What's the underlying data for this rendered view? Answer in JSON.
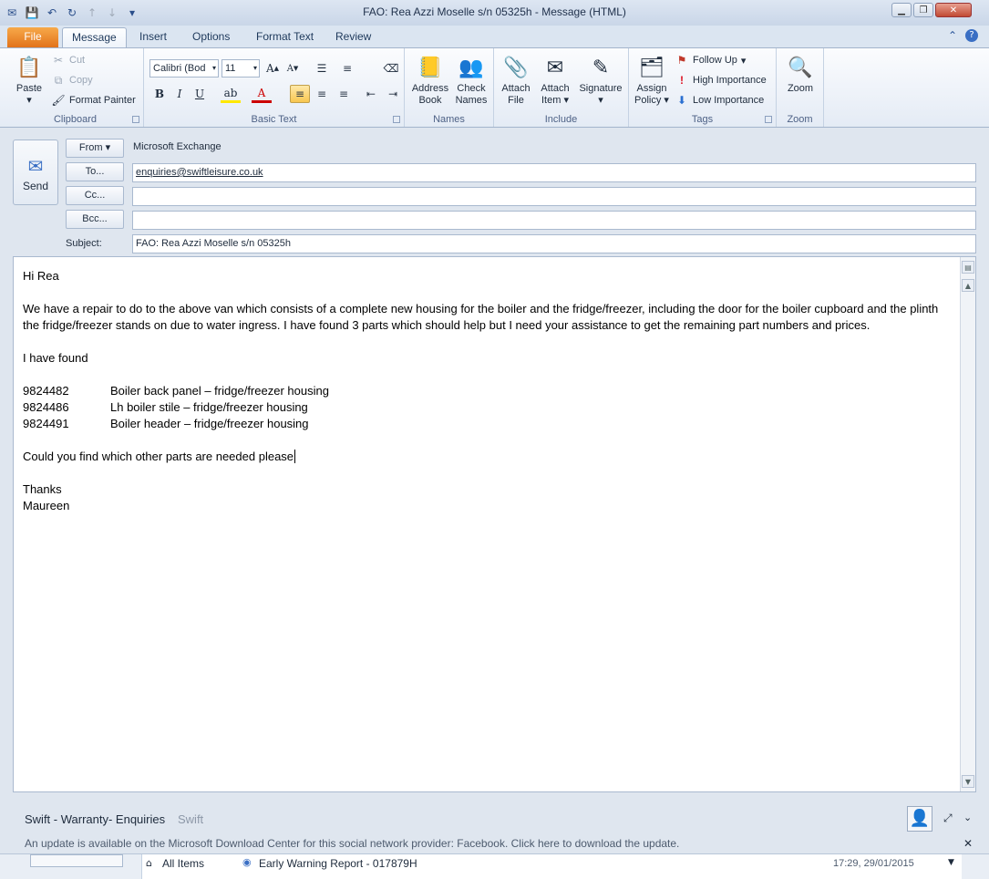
{
  "window": {
    "title": "FAO: Rea Azzi  Moselle  s/n 05325h  -  Message (HTML)"
  },
  "tabs": [
    "File",
    "Message",
    "Insert",
    "Options",
    "Format Text",
    "Review"
  ],
  "ribbon": {
    "clipboard": {
      "paste": "Paste",
      "cut": "Cut",
      "copy": "Copy",
      "format_painter": "Format Painter",
      "label": "Clipboard"
    },
    "basic_text": {
      "font": "Calibri (Bod",
      "size": "11",
      "label": "Basic Text"
    },
    "names": {
      "address_book": [
        "Address",
        "Book"
      ],
      "check_names": [
        "Check",
        "Names"
      ],
      "label": "Names"
    },
    "include": {
      "attach_file": [
        "Attach",
        "File"
      ],
      "attach_item": [
        "Attach",
        "Item"
      ],
      "signature": "Signature",
      "label": "Include"
    },
    "tags": {
      "assign_policy": [
        "Assign",
        "Policy"
      ],
      "follow_up": "Follow Up",
      "high_importance": "High Importance",
      "low_importance": "Low Importance",
      "label": "Tags"
    },
    "zoom": {
      "zoom": "Zoom",
      "label": "Zoom"
    }
  },
  "compose": {
    "send": "Send",
    "from_btn": "From",
    "from_value": "Microsoft Exchange",
    "to_btn": "To...",
    "to_value": "enquiries@swiftleisure.co.uk",
    "cc_btn": "Cc...",
    "cc_value": "",
    "bcc_btn": "Bcc...",
    "bcc_value": "",
    "subject_label": "Subject:",
    "subject_value": "FAO: Rea Azzi  Moselle  s/n 05325h"
  },
  "message": {
    "greeting": "Hi Rea",
    "para1": "We have a repair to do to the above van which consists of a complete new housing for the boiler and the fridge/freezer, including the door for the boiler cupboard and the plinth the fridge/freezer stands on due to water ingress.  I have found 3 parts which should help but I need your assistance to get the remaining part numbers and prices.",
    "found": "I have found",
    "parts": [
      {
        "number": "9824482",
        "desc": "Boiler back panel – fridge/freezer housing"
      },
      {
        "number": "9824486",
        "desc": "Lh boiler stile – fridge/freezer housing"
      },
      {
        "number": "9824491",
        "desc": "Boiler header – fridge/freezer housing"
      }
    ],
    "question": "Could you find which other parts are needed please",
    "thanks": "Thanks",
    "signoff": "Maureen"
  },
  "social": {
    "name": "Swift - Warranty- Enquiries",
    "source": "Swift",
    "notice": "An update is available on the Microsoft Download Center for this social network provider: Facebook. Click here to download the update.",
    "tab_all": "All Items",
    "item_title": "Early Warning Report - 017879H",
    "item_time": "17:29, 29/01/2015"
  }
}
